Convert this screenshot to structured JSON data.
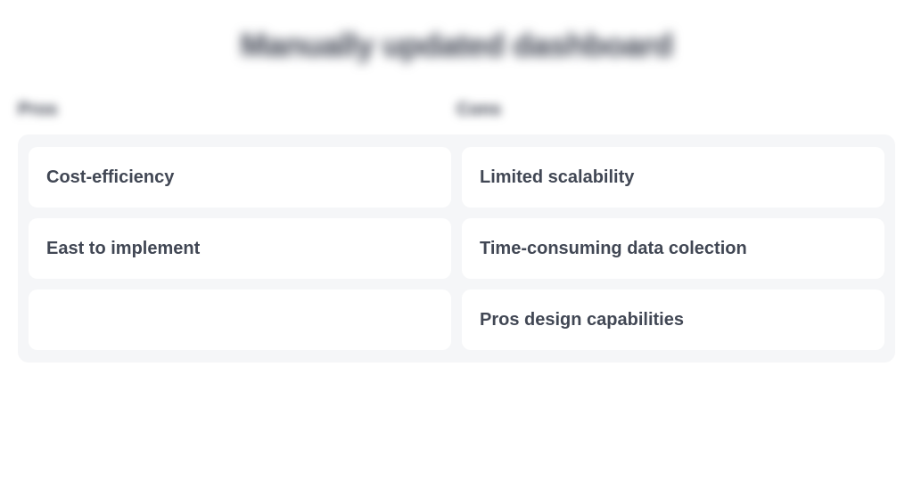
{
  "title": "Manually updated dashboard",
  "leftHeader": "Pros",
  "rightHeader": "Cons",
  "leftItems": [
    "Cost-efficiency",
    "East to implement",
    ""
  ],
  "rightItems": [
    "Limited scalability",
    "Time-consuming data colection",
    "Pros design capabilities"
  ]
}
